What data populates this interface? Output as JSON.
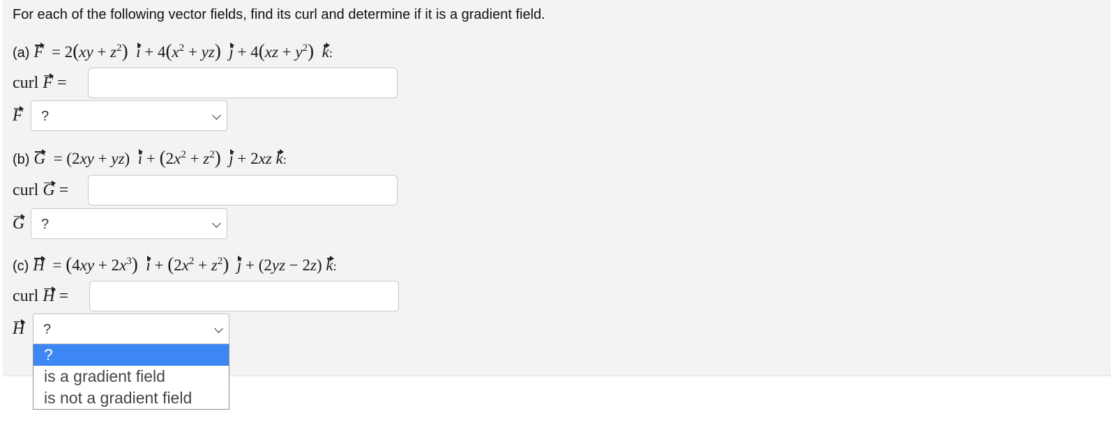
{
  "instructions": "For each of the following vector fields, find its curl and determine if it is a gradient field.",
  "parts": [
    {
      "label": "(a)",
      "field_symbol": "F",
      "formula_parts": [
        "= 2",
        "(",
        "xy + z",
        "2",
        ")",
        " i",
        " + 4",
        "(",
        "x",
        "2",
        " + yz",
        ")",
        " j",
        " + 4",
        "(",
        "xz + y",
        "2",
        ")",
        " k",
        ":"
      ],
      "curl_label": "curl",
      "curl_value": "",
      "select_value": "?"
    },
    {
      "label": "(b)",
      "field_symbol": "G",
      "curl_label": "curl",
      "curl_value": "",
      "select_value": "?"
    },
    {
      "label": "(c)",
      "field_symbol": "H",
      "curl_label": "curl",
      "curl_value": "",
      "select_value": "?"
    }
  ],
  "select_options": [
    "?",
    "is a gradient field",
    "is not a gradient field"
  ],
  "highlighted_option": "?",
  "colors": {
    "panel_bg": "#f3f3f3",
    "selected_option_bg": "#3d87f5",
    "input_border": "#c8c8c8"
  }
}
